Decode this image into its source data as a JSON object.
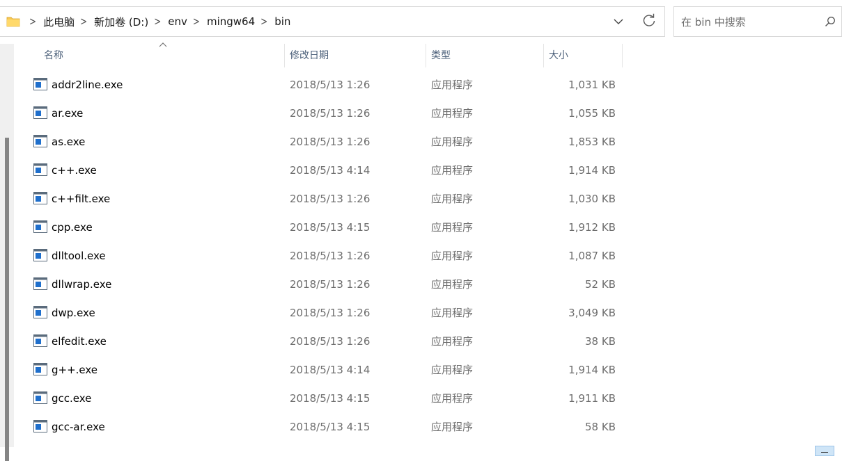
{
  "address": {
    "breadcrumbs": [
      "此电脑",
      "新加卷 (D:)",
      "env",
      "mingw64",
      "bin"
    ]
  },
  "search": {
    "placeholder": "在 bin 中搜索"
  },
  "columns": {
    "name": "名称",
    "date": "修改日期",
    "type": "类型",
    "size": "大小"
  },
  "files": [
    {
      "name": "addr2line.exe",
      "date": "2018/5/13 1:26",
      "type": "应用程序",
      "size": "1,031 KB"
    },
    {
      "name": "ar.exe",
      "date": "2018/5/13 1:26",
      "type": "应用程序",
      "size": "1,055 KB"
    },
    {
      "name": "as.exe",
      "date": "2018/5/13 1:26",
      "type": "应用程序",
      "size": "1,853 KB"
    },
    {
      "name": "c++.exe",
      "date": "2018/5/13 4:14",
      "type": "应用程序",
      "size": "1,914 KB"
    },
    {
      "name": "c++filt.exe",
      "date": "2018/5/13 1:26",
      "type": "应用程序",
      "size": "1,030 KB"
    },
    {
      "name": "cpp.exe",
      "date": "2018/5/13 4:15",
      "type": "应用程序",
      "size": "1,912 KB"
    },
    {
      "name": "dlltool.exe",
      "date": "2018/5/13 1:26",
      "type": "应用程序",
      "size": "1,087 KB"
    },
    {
      "name": "dllwrap.exe",
      "date": "2018/5/13 1:26",
      "type": "应用程序",
      "size": "52 KB"
    },
    {
      "name": "dwp.exe",
      "date": "2018/5/13 1:26",
      "type": "应用程序",
      "size": "3,049 KB"
    },
    {
      "name": "elfedit.exe",
      "date": "2018/5/13 1:26",
      "type": "应用程序",
      "size": "38 KB"
    },
    {
      "name": "g++.exe",
      "date": "2018/5/13 4:14",
      "type": "应用程序",
      "size": "1,914 KB"
    },
    {
      "name": "gcc.exe",
      "date": "2018/5/13 4:15",
      "type": "应用程序",
      "size": "1,911 KB"
    },
    {
      "name": "gcc-ar.exe",
      "date": "2018/5/13 4:15",
      "type": "应用程序",
      "size": "58 KB"
    }
  ],
  "icons": {
    "folder": "folder-icon",
    "file": "exe-file-icon",
    "search": "search-icon",
    "refresh": "refresh-icon",
    "dropdown": "chevron-down-icon",
    "separator": "chevron-right-icon"
  },
  "colors": {
    "folder": "#f8c752",
    "exe_blue": "#1f6fcc",
    "header_text": "#4c607a"
  }
}
